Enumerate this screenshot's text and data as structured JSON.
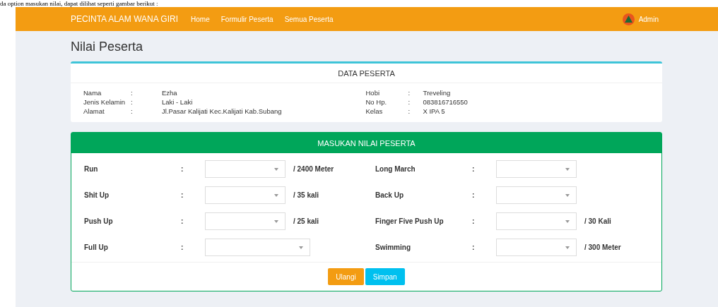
{
  "caption": "da option masukan nilai, dapat dilihat seperti gambar berikut :",
  "navbar": {
    "brand": "PECINTA ALAM WANA GIRI",
    "links": [
      "Home",
      "Formulir Peserta",
      "Semua Peserta"
    ],
    "user": "Admin"
  },
  "page_title": "Nilai Peserta",
  "data_card": {
    "title": "DATA PESERTA",
    "left": [
      {
        "label": "Nama",
        "sep": ":",
        "value": "Ezha"
      },
      {
        "label": "Jenis Kelamin",
        "sep": ":",
        "value": "Laki - Laki"
      },
      {
        "label": "Alamat",
        "sep": ":",
        "value": "Jl.Pasar Kalijati Kec.Kalijati Kab.Subang"
      }
    ],
    "right": [
      {
        "label": "Hobi",
        "sep": ":",
        "value": "Treveling"
      },
      {
        "label": "No Hp.",
        "sep": ":",
        "value": "083816716550"
      },
      {
        "label": "Kelas",
        "sep": ":",
        "value": "X IPA 5"
      }
    ]
  },
  "score_form": {
    "title": "MASUKAN NILAI PESERTA",
    "left": [
      {
        "label": "Run",
        "sep": ":",
        "wide": false,
        "unit": "/ 2400 Meter"
      },
      {
        "label": "Shit Up",
        "sep": ":",
        "wide": false,
        "unit": "/ 35 kali"
      },
      {
        "label": "Push Up",
        "sep": ":",
        "wide": false,
        "unit": "/ 25 kali"
      },
      {
        "label": "Full Up",
        "sep": ":",
        "wide": true
      }
    ],
    "right": [
      {
        "label": "Long March",
        "sep": ":",
        "wide": false
      },
      {
        "label": "Back Up",
        "sep": ":",
        "wide": false
      },
      {
        "label": "Finger Five Push Up",
        "sep": ":",
        "wide": false,
        "unit": "/ 30 Kali"
      },
      {
        "label": "Swimming",
        "sep": ":",
        "wide": false,
        "unit": "/ 300 Meter"
      }
    ],
    "buttons": [
      {
        "label": "Ulangi",
        "kind": "reset"
      },
      {
        "label": "Simpan",
        "kind": "submit"
      }
    ]
  }
}
